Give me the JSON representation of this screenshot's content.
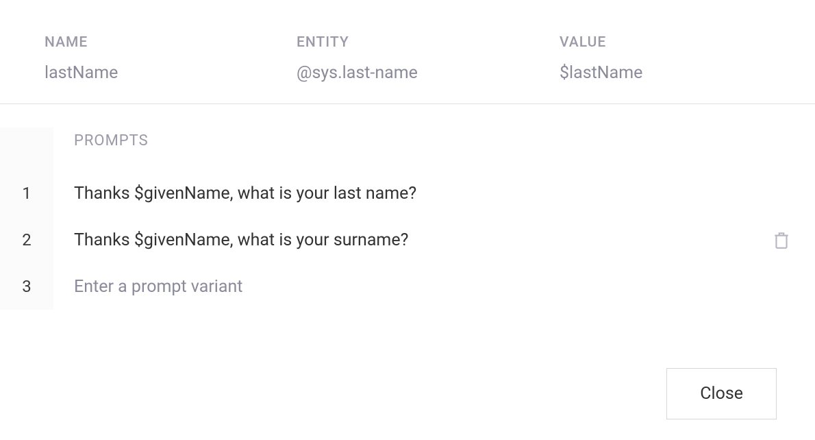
{
  "header": {
    "name": {
      "label": "NAME",
      "value": "lastName"
    },
    "entity": {
      "label": "ENTITY",
      "value": "@sys.last-name"
    },
    "value": {
      "label": "VALUE",
      "value": "$lastName"
    }
  },
  "prompts": {
    "title": "PROMPTS",
    "rows": [
      {
        "index": "1",
        "text": "Thanks $givenName, what is your last name?",
        "showDelete": false
      },
      {
        "index": "2",
        "text": "Thanks $givenName, what is your surname?",
        "showDelete": true
      },
      {
        "index": "3",
        "text": "",
        "placeholder": "Enter a prompt variant",
        "showDelete": false
      }
    ]
  },
  "footer": {
    "close_label": "Close"
  },
  "icons": {
    "trash": "trash-icon"
  }
}
